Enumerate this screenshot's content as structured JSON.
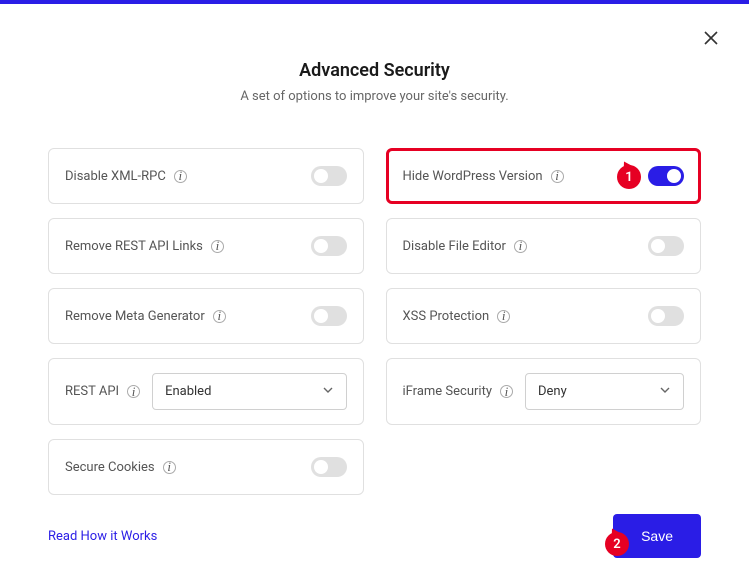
{
  "header": {
    "title": "Advanced Security",
    "subtitle": "A set of options to improve your site's security."
  },
  "options": {
    "disable_xml_rpc": {
      "label": "Disable XML-RPC",
      "value": false
    },
    "hide_wp_version": {
      "label": "Hide WordPress Version",
      "value": true
    },
    "remove_rest_links": {
      "label": "Remove REST API Links",
      "value": false
    },
    "disable_file_editor": {
      "label": "Disable File Editor",
      "value": false
    },
    "remove_meta_generator": {
      "label": "Remove Meta Generator",
      "value": false
    },
    "xss_protection": {
      "label": "XSS Protection",
      "value": false
    },
    "rest_api": {
      "label": "REST API",
      "selected": "Enabled"
    },
    "iframe_security": {
      "label": "iFrame Security",
      "selected": "Deny"
    },
    "secure_cookies": {
      "label": "Secure Cookies",
      "value": false
    }
  },
  "footer": {
    "link": "Read How it Works",
    "save": "Save"
  },
  "annotations": {
    "a1": "1",
    "a2": "2"
  }
}
